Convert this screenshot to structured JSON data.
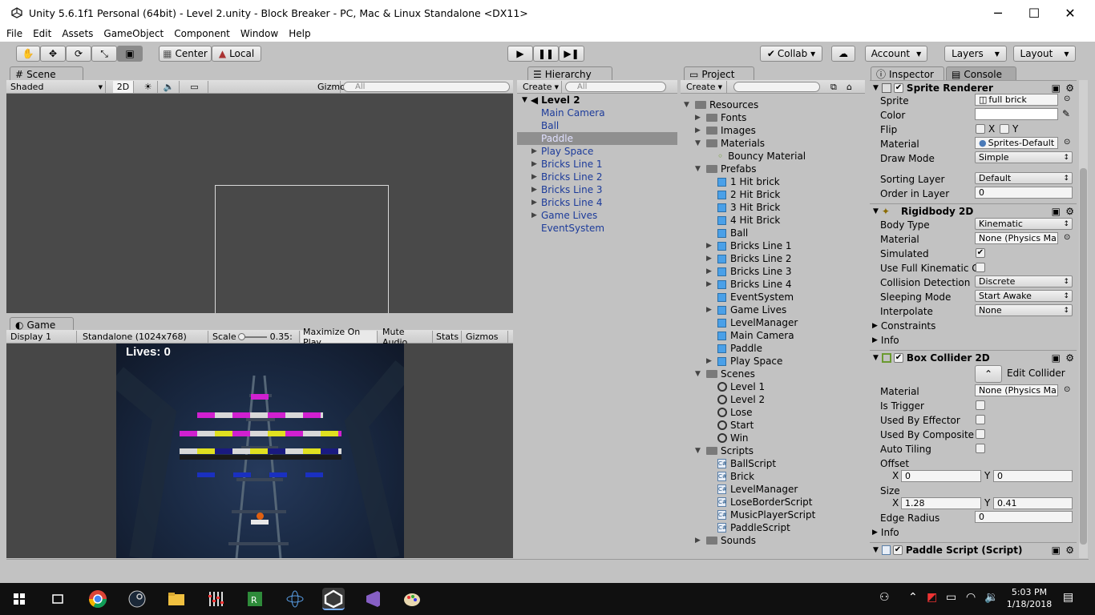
{
  "window": {
    "title": "Unity 5.6.1f1 Personal (64bit) - Level 2.unity - Block Breaker - PC, Mac & Linux Standalone <DX11>",
    "minimize": "─",
    "maximize": "☐",
    "close": "✕"
  },
  "menu": [
    "File",
    "Edit",
    "Assets",
    "GameObject",
    "Component",
    "Window",
    "Help"
  ],
  "toolbar": {
    "pivot": "Center",
    "space": "Local",
    "collab": "Collab ▾",
    "account": "Account",
    "layers": "Layers",
    "layout": "Layout"
  },
  "scene": {
    "tab": "Scene",
    "shading": "Shaded",
    "mode2d": "2D",
    "gizmos": "Gizmos",
    "search_placeholder": "All"
  },
  "game": {
    "tab": "Game",
    "display": "Display 1",
    "resolution": "Standalone (1024x768)",
    "scale_label": "Scale",
    "scale_value": "0.35:",
    "maximize": "Maximize On Play",
    "mute": "Mute Audio",
    "stats": "Stats",
    "gizmos": "Gizmos",
    "lives": "Lives: 0"
  },
  "hierarchy": {
    "tab": "Hierarchy",
    "create": "Create",
    "search_placeholder": "All",
    "scene_name": "Level 2",
    "items": [
      {
        "label": "Main Camera",
        "expandable": false
      },
      {
        "label": "Ball",
        "expandable": false
      },
      {
        "label": "Paddle",
        "expandable": false,
        "selected": true
      },
      {
        "label": "Play Space",
        "expandable": true
      },
      {
        "label": "Bricks Line 1",
        "expandable": true
      },
      {
        "label": "Bricks Line 2",
        "expandable": true
      },
      {
        "label": "Bricks Line 3",
        "expandable": true
      },
      {
        "label": "Bricks Line 4",
        "expandable": true
      },
      {
        "label": "Game Lives",
        "expandable": true
      },
      {
        "label": "EventSystem",
        "expandable": false
      }
    ]
  },
  "project": {
    "tab": "Project",
    "create": "Create",
    "items": [
      {
        "label": "Resources",
        "indent": 0,
        "icon": "folder",
        "open": true
      },
      {
        "label": "Fonts",
        "indent": 1,
        "icon": "folder",
        "open": false
      },
      {
        "label": "Images",
        "indent": 1,
        "icon": "folder",
        "open": false
      },
      {
        "label": "Materials",
        "indent": 1,
        "icon": "folder",
        "open": true
      },
      {
        "label": "Bouncy Material",
        "indent": 2,
        "icon": "material"
      },
      {
        "label": "Prefabs",
        "indent": 1,
        "icon": "folder",
        "open": true
      },
      {
        "label": "1 Hit brick",
        "indent": 2,
        "icon": "cube"
      },
      {
        "label": "2 Hit Brick",
        "indent": 2,
        "icon": "cube"
      },
      {
        "label": "3 Hit Brick",
        "indent": 2,
        "icon": "cube"
      },
      {
        "label": "4 Hit Brick",
        "indent": 2,
        "icon": "cube"
      },
      {
        "label": "Ball",
        "indent": 2,
        "icon": "cube"
      },
      {
        "label": "Bricks Line 1",
        "indent": 2,
        "icon": "cube",
        "open": false
      },
      {
        "label": "Bricks Line 2",
        "indent": 2,
        "icon": "cube",
        "open": false
      },
      {
        "label": "Bricks Line 3",
        "indent": 2,
        "icon": "cube",
        "open": false
      },
      {
        "label": "Bricks Line 4",
        "indent": 2,
        "icon": "cube",
        "open": false
      },
      {
        "label": "EventSystem",
        "indent": 2,
        "icon": "cube"
      },
      {
        "label": "Game Lives",
        "indent": 2,
        "icon": "cube",
        "open": false
      },
      {
        "label": "LevelManager",
        "indent": 2,
        "icon": "cube"
      },
      {
        "label": "Main Camera",
        "indent": 2,
        "icon": "cube"
      },
      {
        "label": "Paddle",
        "indent": 2,
        "icon": "cube"
      },
      {
        "label": "Play Space",
        "indent": 2,
        "icon": "cube",
        "open": false
      },
      {
        "label": "Scenes",
        "indent": 1,
        "icon": "folder",
        "open": true
      },
      {
        "label": "Level 1",
        "indent": 2,
        "icon": "unity"
      },
      {
        "label": "Level 2",
        "indent": 2,
        "icon": "unity"
      },
      {
        "label": "Lose",
        "indent": 2,
        "icon": "unity"
      },
      {
        "label": "Start",
        "indent": 2,
        "icon": "unity"
      },
      {
        "label": "Win",
        "indent": 2,
        "icon": "unity"
      },
      {
        "label": "Scripts",
        "indent": 1,
        "icon": "folder",
        "open": true
      },
      {
        "label": "BallScript",
        "indent": 2,
        "icon": "script"
      },
      {
        "label": "Brick",
        "indent": 2,
        "icon": "script"
      },
      {
        "label": "LevelManager",
        "indent": 2,
        "icon": "script"
      },
      {
        "label": "LoseBorderScript",
        "indent": 2,
        "icon": "script"
      },
      {
        "label": "MusicPlayerScript",
        "indent": 2,
        "icon": "script"
      },
      {
        "label": "PaddleScript",
        "indent": 2,
        "icon": "script"
      },
      {
        "label": "Sounds",
        "indent": 1,
        "icon": "folder",
        "open": false
      }
    ]
  },
  "inspector": {
    "tab": "Inspector",
    "console_tab": "Console",
    "sprite_renderer": {
      "title": "Sprite Renderer",
      "sprite_label": "Sprite",
      "sprite": "full brick",
      "color_label": "Color",
      "flip_label": "Flip",
      "flip_x": "X",
      "flip_y": "Y",
      "material_label": "Material",
      "material": "Sprites-Default",
      "draw_mode_label": "Draw Mode",
      "draw_mode": "Simple",
      "sorting_layer_label": "Sorting Layer",
      "sorting_layer": "Default",
      "order_label": "Order in Layer",
      "order": "0"
    },
    "rigidbody": {
      "title": "Rigidbody 2D",
      "body_type_label": "Body Type",
      "body_type": "Kinematic",
      "material_label": "Material",
      "material": "None (Physics Ma",
      "simulated_label": "Simulated",
      "kinematic_contacts_label": "Use Full Kinematic C",
      "collision_label": "Collision Detection",
      "collision": "Discrete",
      "sleeping_label": "Sleeping Mode",
      "sleeping": "Start Awake",
      "interpolate_label": "Interpolate",
      "interpolate": "None",
      "constraints": "Constraints",
      "info": "Info"
    },
    "box_collider": {
      "title": "Box Collider 2D",
      "edit_collider": "Edit Collider",
      "material_label": "Material",
      "material": "None (Physics Ma",
      "trigger_label": "Is Trigger",
      "effector_label": "Used By Effector",
      "composite_label": "Used By Composite",
      "auto_tiling_label": "Auto Tiling",
      "offset_label": "Offset",
      "offset_x": "0",
      "offset_y": "0",
      "size_label": "Size",
      "size_x": "1.28",
      "size_y": "0.41",
      "edge_label": "Edge Radius",
      "edge": "0",
      "info": "Info",
      "x": "X",
      "y": "Y"
    },
    "paddle_script": {
      "title": "Paddle Script (Script)"
    }
  },
  "taskbar": {
    "time": "5:03 PM",
    "date": "1/18/2018"
  },
  "colors": {
    "editor_bg": "#c2c2c2",
    "scene_bg": "#494949",
    "selection": "#8f8f8f",
    "hier_text": "#1c3b9a"
  }
}
